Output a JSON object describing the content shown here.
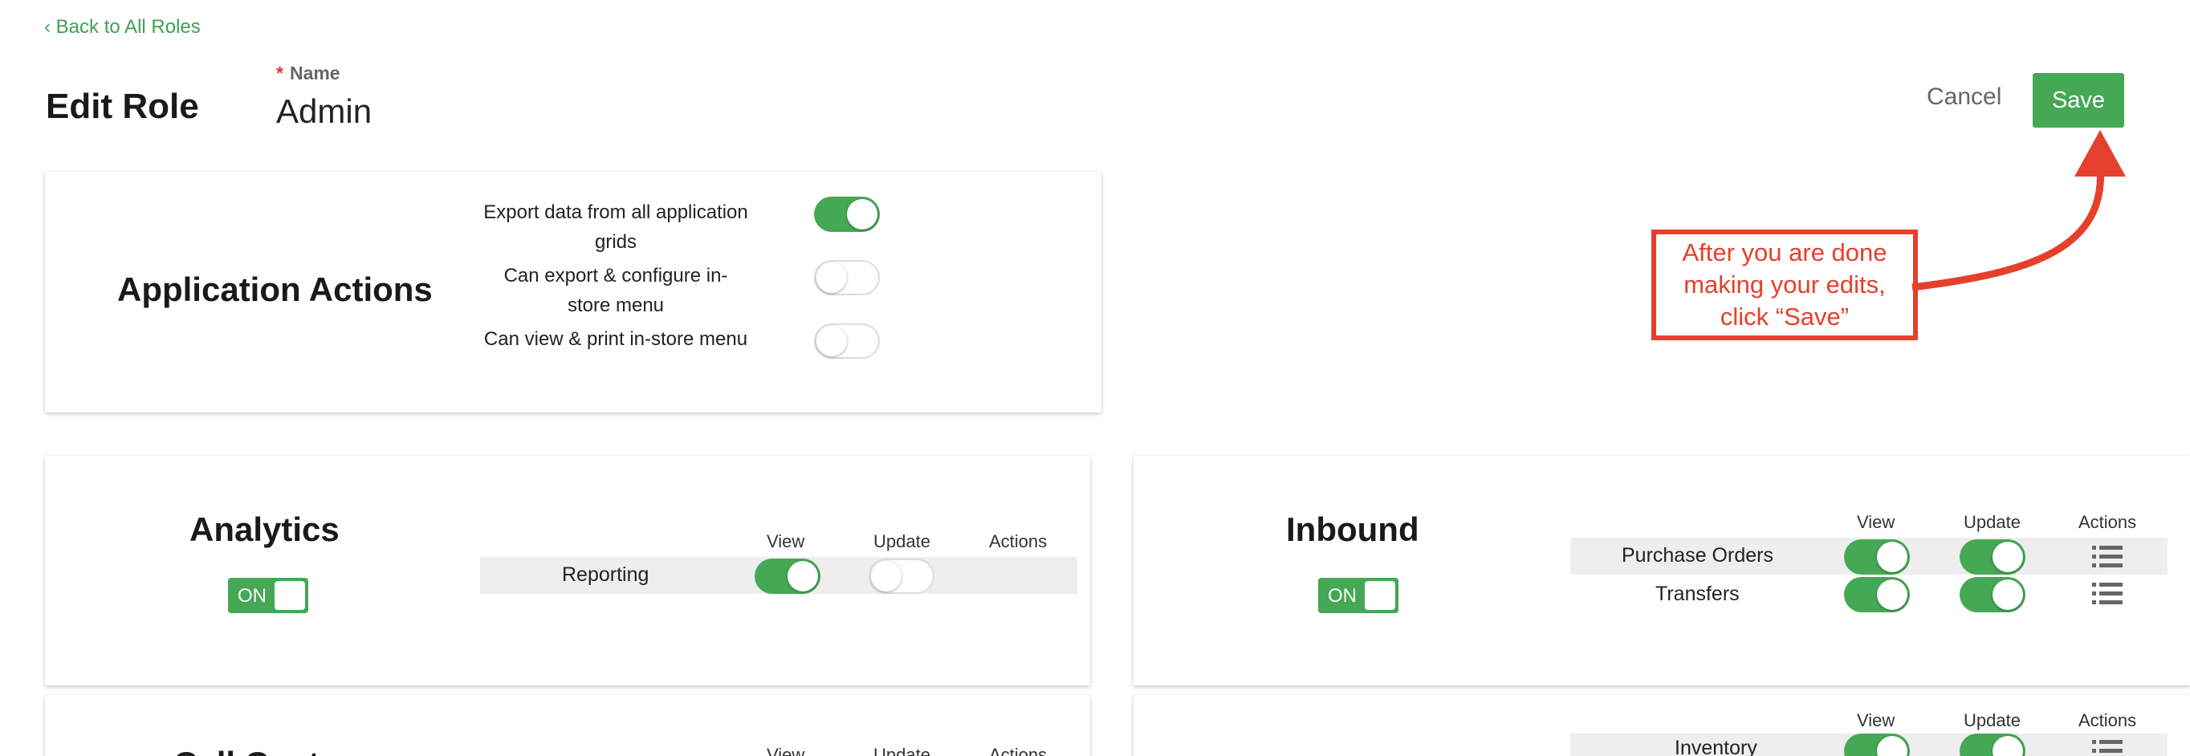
{
  "header": {
    "back_link": "Back to All Roles",
    "title": "Edit Role",
    "name_required_mark": "*",
    "name_label": "Name",
    "name_value": "Admin",
    "cancel_label": "Cancel",
    "save_label": "Save"
  },
  "application_actions": {
    "title": "Application Actions",
    "items": [
      {
        "label": "Export data from all application grids",
        "enabled": true
      },
      {
        "label": "Can export & configure in-store menu",
        "enabled": false
      },
      {
        "label": "Can view & print in-store menu",
        "enabled": false
      }
    ]
  },
  "columns": {
    "view": "View",
    "update": "Update",
    "actions": "Actions"
  },
  "analytics": {
    "title": "Analytics",
    "switch_label": "ON",
    "rows": [
      {
        "label": "Reporting",
        "view": true,
        "update": false
      }
    ]
  },
  "inbound": {
    "title": "Inbound",
    "switch_label": "ON",
    "rows": [
      {
        "label": "Purchase Orders",
        "view": true,
        "update": true
      },
      {
        "label": "Transfers",
        "view": true,
        "update": true
      }
    ]
  },
  "call_center": {
    "title": "Call Center"
  },
  "inventory_section": {
    "rows": [
      {
        "label": "Inventory",
        "view": true,
        "update": true
      }
    ]
  },
  "annotation": {
    "callout_text": "After you are done making your edits, click “Save”",
    "color": "#e5402c"
  },
  "colors": {
    "accent": "#45a854",
    "link": "#3fa24f"
  },
  "icons": {
    "back": "chevron-left-icon",
    "actions": "list-icon"
  }
}
